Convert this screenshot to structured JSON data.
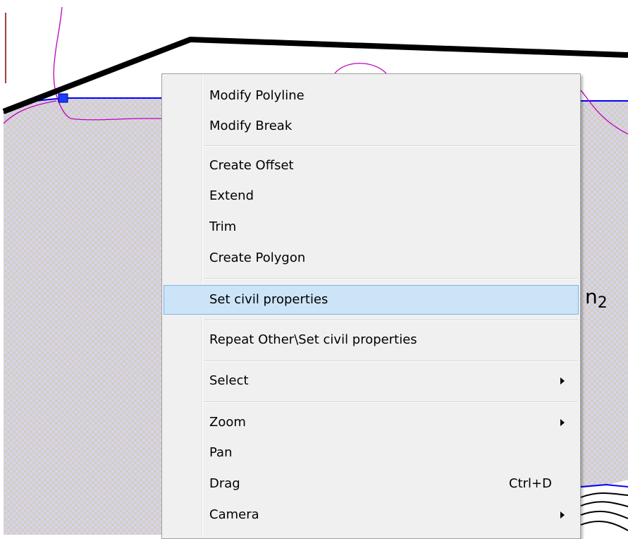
{
  "drawing": {
    "annotation_main": "n",
    "annotation_sub": "2"
  },
  "context_menu": {
    "items": [
      {
        "label": "Modify Polyline"
      },
      {
        "label": "Modify Break"
      },
      {
        "label": "Create Offset"
      },
      {
        "label": "Extend"
      },
      {
        "label": "Trim"
      },
      {
        "label": "Create Polygon"
      },
      {
        "label": "Set civil properties",
        "highlighted": true
      },
      {
        "label": "Repeat Other\\Set civil properties"
      },
      {
        "label": "Select",
        "submenu": true
      },
      {
        "label": "Zoom",
        "submenu": true
      },
      {
        "label": "Pan"
      },
      {
        "label": "Drag",
        "shortcut": "Ctrl+D"
      },
      {
        "label": "Camera",
        "submenu": true
      }
    ]
  },
  "colors": {
    "hatch": "#c8c8e6",
    "boundary_line": "#000000",
    "blue_line": "#0000ff",
    "contour": "#c000c0",
    "highlight": "#cce4f7"
  }
}
